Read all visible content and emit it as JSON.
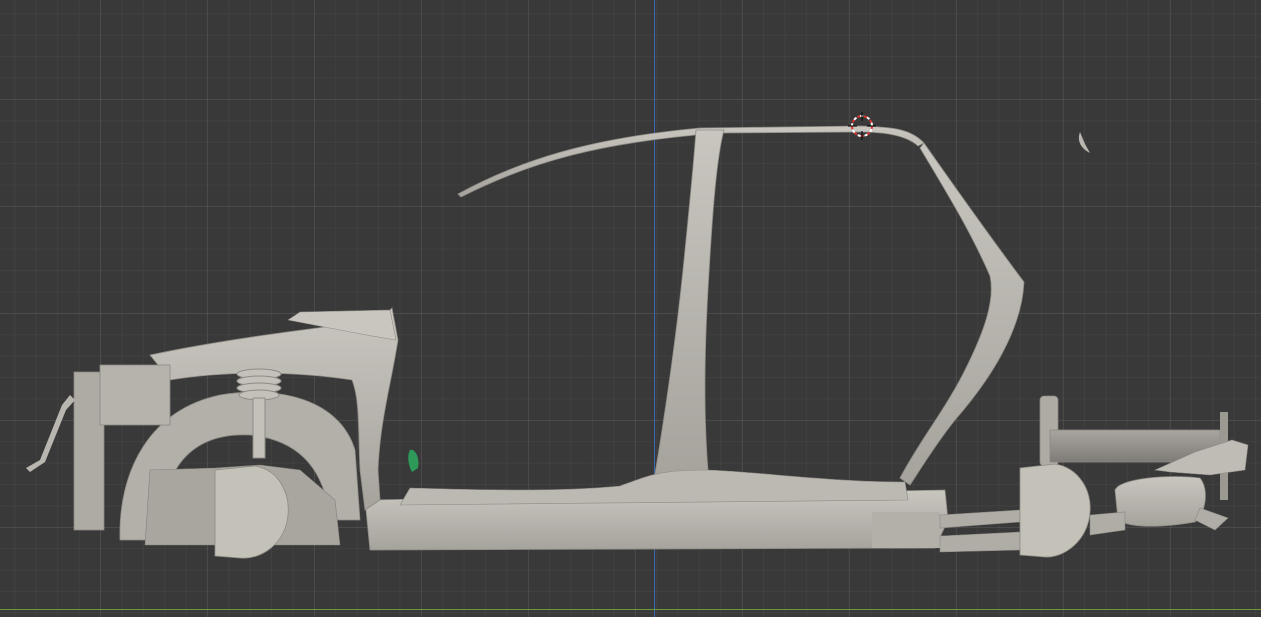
{
  "viewport": {
    "background": "#393939",
    "grid": true,
    "axis_colors": {
      "z_axis": "#3a6ab0",
      "y_axis": "#6a9a3a"
    }
  },
  "scene": {
    "object": "car-body-frame-side-view",
    "mesh_color": "#b9b6b0",
    "mesh_shadow": "#8f8c86"
  },
  "cursor": {
    "icon": "3d-cursor-icon",
    "color_a": "#d33",
    "color_b": "#ffffff"
  }
}
